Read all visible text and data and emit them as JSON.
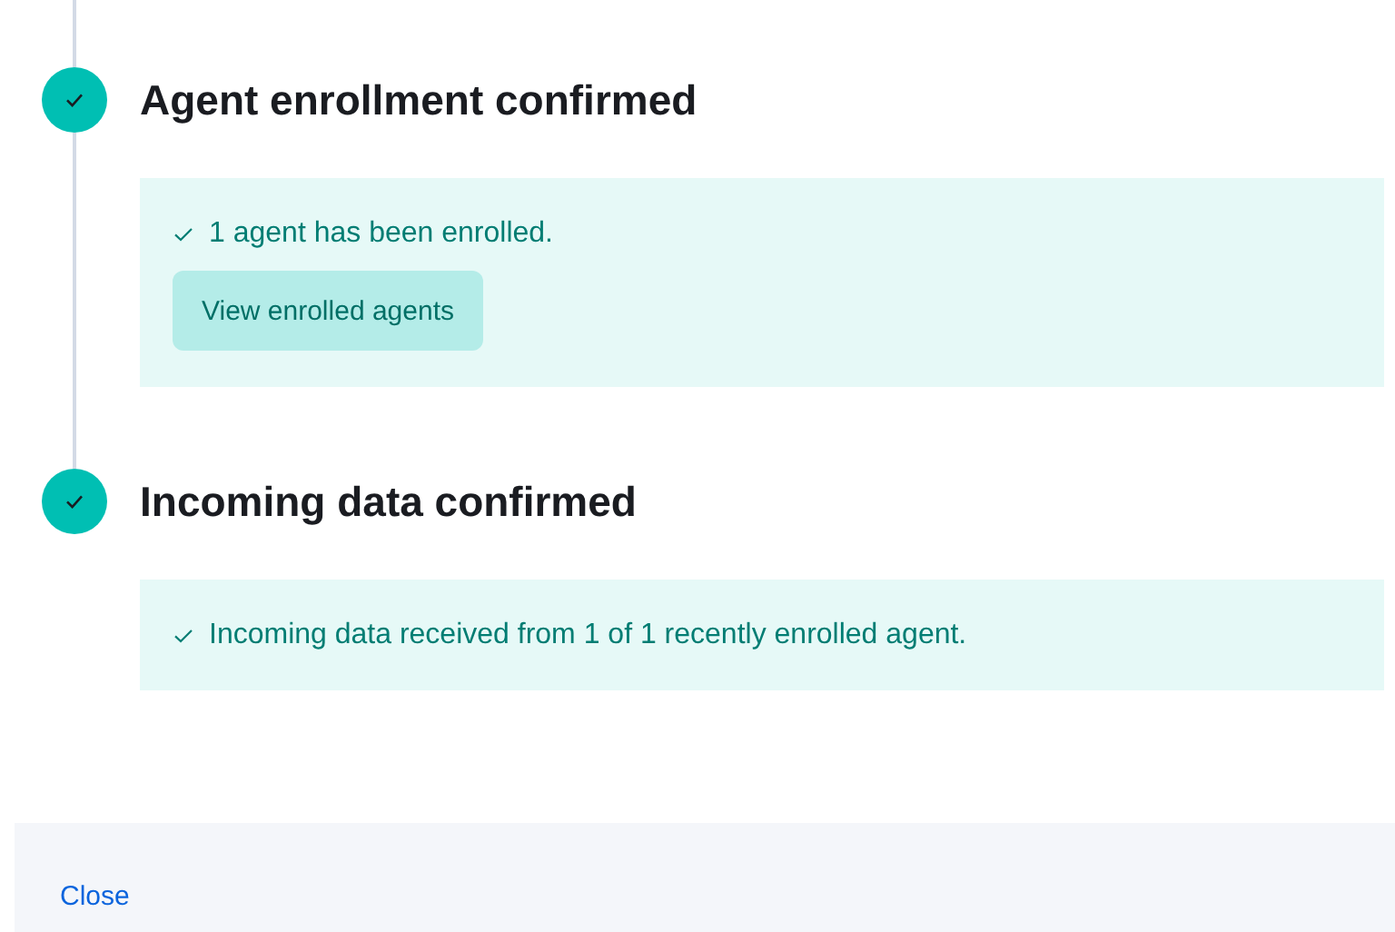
{
  "steps": [
    {
      "title": "Agent enrollment confirmed",
      "complete": true,
      "callout": {
        "message": "1 agent has been enrolled.",
        "button": "View enrolled agents"
      }
    },
    {
      "title": "Incoming data confirmed",
      "complete": true,
      "callout": {
        "message": "Incoming data received from 1 of 1 recently enrolled agent."
      }
    }
  ],
  "footer": {
    "close_link": "Close"
  }
}
